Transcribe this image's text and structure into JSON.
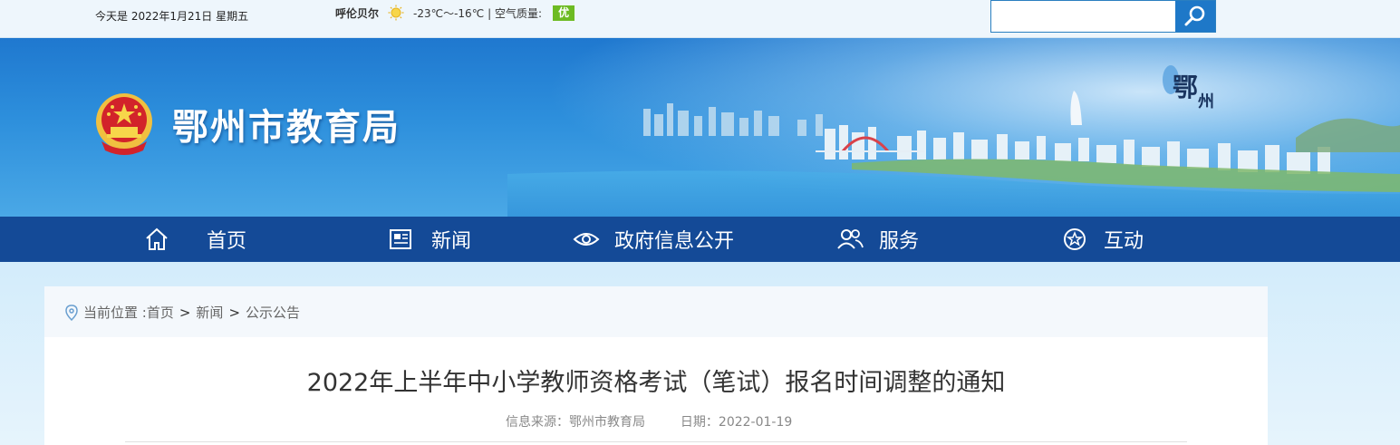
{
  "topbar": {
    "date_text": "今天是 2022年1月21日 星期五",
    "city": "呼伦贝尔",
    "temperature": "-23℃～-16℃",
    "air_quality_label": "| 空气质量:",
    "air_quality_value": "优",
    "search_placeholder": ""
  },
  "banner": {
    "site_title": "鄂州市教育局",
    "seal_text": "鄂州"
  },
  "nav": {
    "items": [
      {
        "label": "首页",
        "icon": "home-icon"
      },
      {
        "label": "新闻",
        "icon": "news-icon"
      },
      {
        "label": "政府信息公开",
        "icon": "eye-icon"
      },
      {
        "label": "服务",
        "icon": "people-icon"
      },
      {
        "label": "互动",
        "icon": "star-icon"
      }
    ]
  },
  "breadcrumb": {
    "prefix": "当前位置 :",
    "items": [
      "首页",
      "新闻",
      "公示公告"
    ],
    "separator": ">"
  },
  "article": {
    "title": "2022年上半年中小学教师资格考试（笔试）报名时间调整的通知",
    "source": "信息来源：鄂州市教育局",
    "date": "日期：2022-01-19"
  },
  "colors": {
    "nav_bg": "#144a97",
    "aq_badge": "#6dbb22",
    "search_btn": "#1e78c8"
  }
}
